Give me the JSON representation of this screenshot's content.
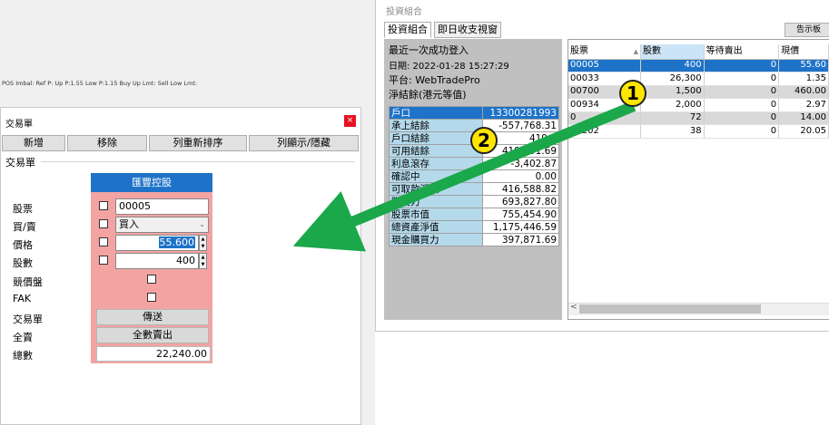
{
  "background": {
    "pos_bar_text": "POS Imbal:  Ref P:  Up P:1.55  Low P:1.15  Buy Up Lmt:  Sell Low Lmt:"
  },
  "order_window": {
    "title": "交易單",
    "close_icon": "×",
    "toolbar": {
      "add_label": "新增",
      "remove_label": "移除",
      "reorder_label": "列重新排序",
      "show_hide_label": "列顯示/隱藏"
    },
    "group_label": "交易單",
    "account_header": "匯豐控股",
    "labels": {
      "stock": "股票",
      "buy_sell": "買/賣",
      "price": "價格",
      "quantity": "股數",
      "auction": "競價盤",
      "fak": "FAK",
      "order": "交易單",
      "all": "全賣",
      "total": "總數"
    },
    "stock_value": "00005",
    "side_value": "買入",
    "price_value": "55.600",
    "quantity_value": "400",
    "send_label": "傳送",
    "sell_all_label": "全數賣出",
    "total_value": "22,240.00"
  },
  "portfolio": {
    "window_title": "投資組合",
    "tabs": [
      "投資組合",
      "即日收支視窗"
    ],
    "notice_label": "告示板",
    "last_login_label": "最近一次成功登入",
    "date_line": "日期: 2022-01-28 15:27:29",
    "platform_line": "平台: WebTradePro",
    "net_balance_label": "淨結餘(港元等值)",
    "balances": [
      {
        "label": "戶口",
        "value": "13300281993"
      },
      {
        "label": "承上結餘",
        "value": "-557,768.31"
      },
      {
        "label": "戶口結餘",
        "value": "419,0"
      },
      {
        "label": "可用結餘",
        "value": "419,991.69"
      },
      {
        "label": "利息滾存",
        "value": "-3,402.87"
      },
      {
        "label": "確認中",
        "value": "0.00"
      },
      {
        "label": "可取款淨額",
        "value": "416,588.82"
      },
      {
        "label": "購買力",
        "value": "693,827.80"
      },
      {
        "label": "股票市值",
        "value": "755,454.90"
      },
      {
        "label": "總資產淨值",
        "value": "1,175,446.59"
      },
      {
        "label": "現金購買力",
        "value": "397,871.69"
      }
    ],
    "holdings_columns": [
      "股票",
      "股數",
      "等待賣出",
      "現價"
    ],
    "holdings": [
      {
        "code": "00005",
        "qty": "400",
        "pending": "0",
        "price": "55.60"
      },
      {
        "code": "00033",
        "qty": "26,300",
        "pending": "0",
        "price": "1.35"
      },
      {
        "code": "00700",
        "qty": "1,500",
        "pending": "0",
        "price": "460.00"
      },
      {
        "code": "00934",
        "qty": "2,000",
        "pending": "0",
        "price": "2.97"
      },
      {
        "code": "0",
        "qty": "72",
        "pending": "0",
        "price": "14.00"
      },
      {
        "code": "02202",
        "qty": "38",
        "pending": "0",
        "price": "20.05"
      }
    ],
    "scroll_left_icon": "<"
  },
  "annotations": {
    "marker_1": "1",
    "marker_2": "2",
    "arrow_color": "#1aa84a",
    "marker_color": "#ffe600"
  }
}
